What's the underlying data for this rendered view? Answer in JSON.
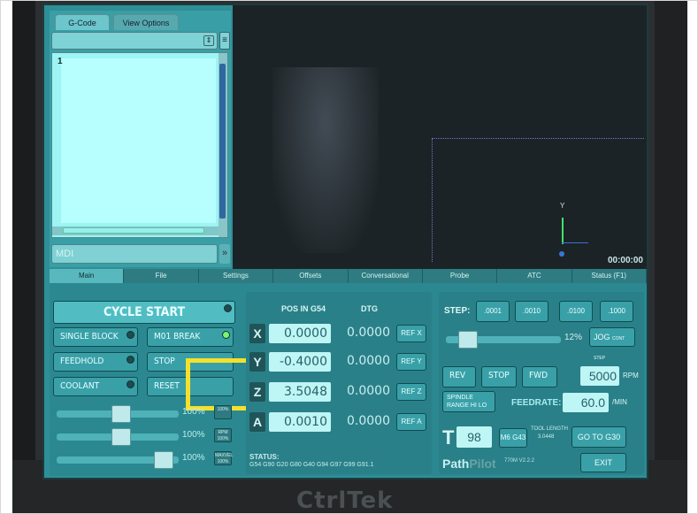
{
  "gcode_panel": {
    "tabs": [
      "G-Code",
      "View Options"
    ],
    "line_number": "1",
    "mdi_placeholder": "MDI"
  },
  "toolpath": {
    "y_axis_label": "Y",
    "timer": "00:00:00"
  },
  "main_tabs": [
    "Main",
    "File",
    "Settings",
    "Offsets",
    "Conversational",
    "Probe",
    "ATC",
    "Status (F1)"
  ],
  "controls": {
    "cycle_start": "CYCLE START",
    "single_block": "SINGLE BLOCK",
    "m01_break": "M01 BREAK",
    "feedhold": "FEEDHOLD",
    "stop": "STOP",
    "coolant": "COOLANT",
    "reset": "RESET"
  },
  "overrides": {
    "feed_pct": "100%",
    "feed_btn": "100%",
    "rpm_pct": "100%",
    "rpm_btn": "RPM 100%",
    "maxvel_pct": "100%",
    "maxvel_btn": "MAXVEL 100%"
  },
  "dro": {
    "pos_header": "POS IN G54",
    "dtg_header": "DTG",
    "axes": [
      {
        "axis": "X",
        "pos": "0.0000",
        "dtg": "0.0000",
        "ref": "REF X"
      },
      {
        "axis": "Y",
        "pos": "-0.4000",
        "dtg": "0.0000",
        "ref": "REF Y"
      },
      {
        "axis": "Z",
        "pos": "3.5048",
        "dtg": "0.0000",
        "ref": "REF Z"
      },
      {
        "axis": "A",
        "pos": "0.0010",
        "dtg": "0.0000",
        "ref": "REF A"
      }
    ],
    "status_label": "STATUS:",
    "status_codes": "G54 G90 G20 G80 G40 G94 G97 G99 G91.1"
  },
  "spindle": {
    "step_label": "STEP:",
    "steps": [
      ".0001",
      ".0010",
      ".0100",
      ".1000"
    ],
    "spindle_pct": "12%",
    "jog_label": "JOG",
    "jog_sub": "CONT STEP",
    "rev": "REV",
    "stop": "STOP",
    "fwd": "FWD",
    "rpm_value": "5000",
    "rpm_unit": "RPM",
    "range_label": "SPINDLE RANGE",
    "range_hi": "HI",
    "range_lo": "LO",
    "feedrate_label": "FEEDRATE:",
    "feedrate_value": "60.0",
    "feedrate_unit": "/MIN",
    "tool_letter": "T",
    "tool_number": "98",
    "m6g43": "M6 G43",
    "tool_length_label": "TOOL LENGTH",
    "tool_length_value": "3.0448",
    "goto_g30": "GO TO G30",
    "pathpilot_a": "Path",
    "pathpilot_b": "Pilot",
    "version": "770M V2.2.2",
    "exit": "EXIT"
  },
  "bezel_brand": "CtrlTek"
}
